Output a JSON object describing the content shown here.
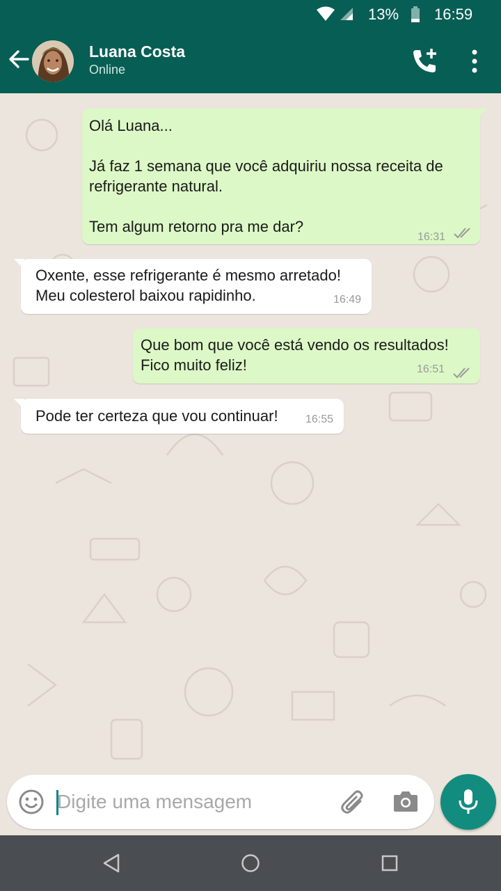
{
  "status_bar": {
    "battery_percent": "13%",
    "time": "16:59",
    "icons": [
      "wifi-icon",
      "signal-icon",
      "battery-icon"
    ]
  },
  "header": {
    "contact_name": "Luana Costa",
    "contact_status": "Online",
    "icons": [
      "back-arrow-icon",
      "add-call-icon",
      "more-vert-icon"
    ]
  },
  "messages": [
    {
      "direction": "outgoing",
      "text": "Olá Luana...\n\nJá faz 1 semana que você adquiriu nossa receita de\nrefrigerante natural.\n\nTem algum retorno pra me dar?",
      "time": "16:31",
      "read_receipt": "double-check-icon"
    },
    {
      "direction": "incoming",
      "text": "Oxente, esse refrigerante é mesmo arretado!\nMeu colesterol baixou rapidinho.",
      "time": "16:49"
    },
    {
      "direction": "outgoing",
      "text": "Que bom que você está vendo os resultados!\nFico muito feliz!",
      "time": "16:51",
      "read_receipt": "double-check-icon"
    },
    {
      "direction": "incoming",
      "text": "Pode ter certeza que vou continuar!",
      "time": "16:55"
    }
  ],
  "composer": {
    "placeholder": "Digite uma mensagem",
    "value": "",
    "icons": [
      "emoji-icon",
      "attach-icon",
      "camera-icon",
      "mic-icon"
    ]
  },
  "nav_bar": {
    "icons": [
      "nav-back-icon",
      "nav-home-icon",
      "nav-recents-icon"
    ]
  },
  "colors": {
    "header_bg": "#075e54",
    "chat_bg": "#ece5dd",
    "outgoing_bubble": "#dcf8c6",
    "incoming_bubble": "#ffffff",
    "fab": "#128c7e",
    "nav_bar": "#4a4d52"
  }
}
